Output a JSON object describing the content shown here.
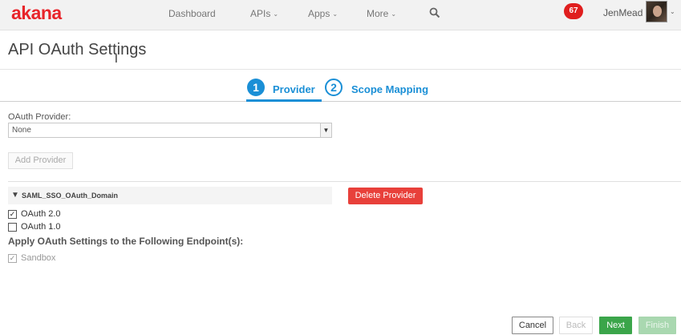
{
  "app": {
    "logo_text": "akana",
    "brand_color": "#e8242a"
  },
  "nav": {
    "items": [
      {
        "label": "Dashboard",
        "has_dropdown": false
      },
      {
        "label": "APIs",
        "has_dropdown": true
      },
      {
        "label": "Apps",
        "has_dropdown": true
      },
      {
        "label": "More",
        "has_dropdown": true
      }
    ],
    "search_icon": "search-icon",
    "notification_count": "67",
    "user_name": "JenMead"
  },
  "page": {
    "title": "API OAuth Settings"
  },
  "steps": [
    {
      "number": "1",
      "label": "Provider",
      "active": true
    },
    {
      "number": "2",
      "label": "Scope Mapping",
      "active": false
    }
  ],
  "form": {
    "provider_label": "OAuth Provider:",
    "provider_selected": "None",
    "add_provider_label": "Add Provider",
    "group_name": "SAML_SSO_OAuth_Domain",
    "delete_provider_label": "Delete Provider",
    "oauth_versions": [
      {
        "label": "OAuth 2.0",
        "checked": true
      },
      {
        "label": "OAuth 1.0",
        "checked": false
      }
    ],
    "endpoints_heading": "Apply OAuth Settings to the Following Endpoint(s):",
    "endpoints": [
      {
        "label": "Sandbox",
        "checked": true,
        "disabled": true
      }
    ]
  },
  "footer": {
    "cancel_label": "Cancel",
    "back_label": "Back",
    "next_label": "Next",
    "finish_label": "Finish"
  },
  "colors": {
    "accent": "#1a8fd6",
    "danger": "#e8403a",
    "success": "#3ba54a",
    "badge": "#e01e1e"
  }
}
